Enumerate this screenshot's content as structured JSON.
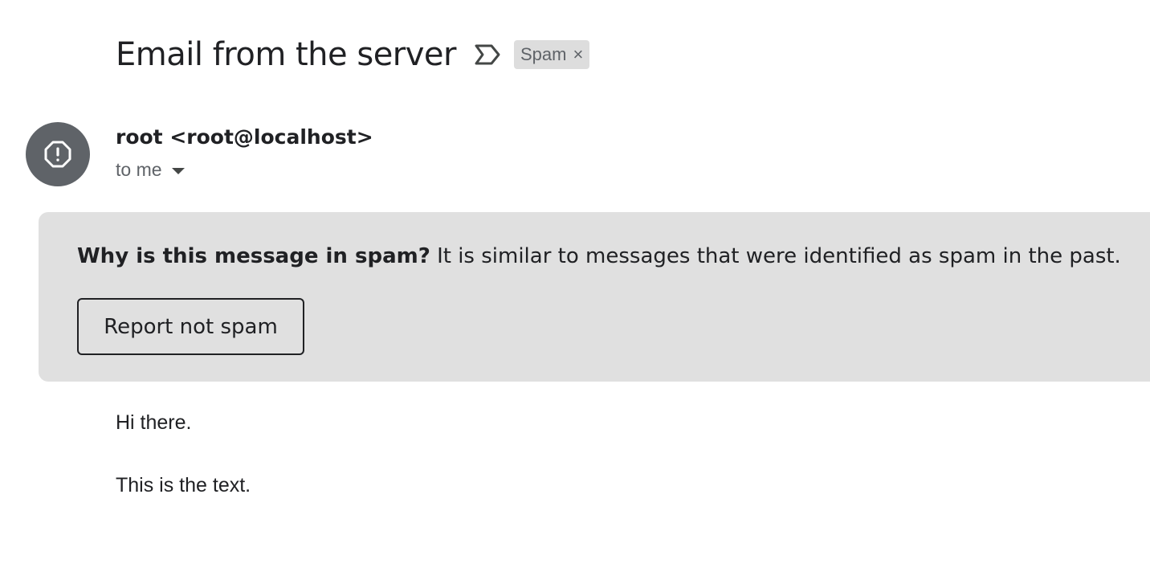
{
  "subject": "Email from the server",
  "importance_icon": "label-importance-icon",
  "label_chip": {
    "label": "Spam",
    "remove_glyph": "×"
  },
  "sender": {
    "avatar_icon": "spam-warning-icon",
    "display": "root <root@localhost>",
    "recipients": "to me"
  },
  "spam_banner": {
    "question": "Why is this message in spam?",
    "reason": " It is similar to messages that were identified as spam in the past.",
    "button_label": "Report not spam",
    "background": "#e0e0e0"
  },
  "body": {
    "lines": [
      "Hi there.",
      "This is the text."
    ]
  },
  "colors": {
    "avatar": "#5f6368",
    "chip": "#dddddd",
    "text": "#202124",
    "secondary_text": "#5f6368"
  }
}
